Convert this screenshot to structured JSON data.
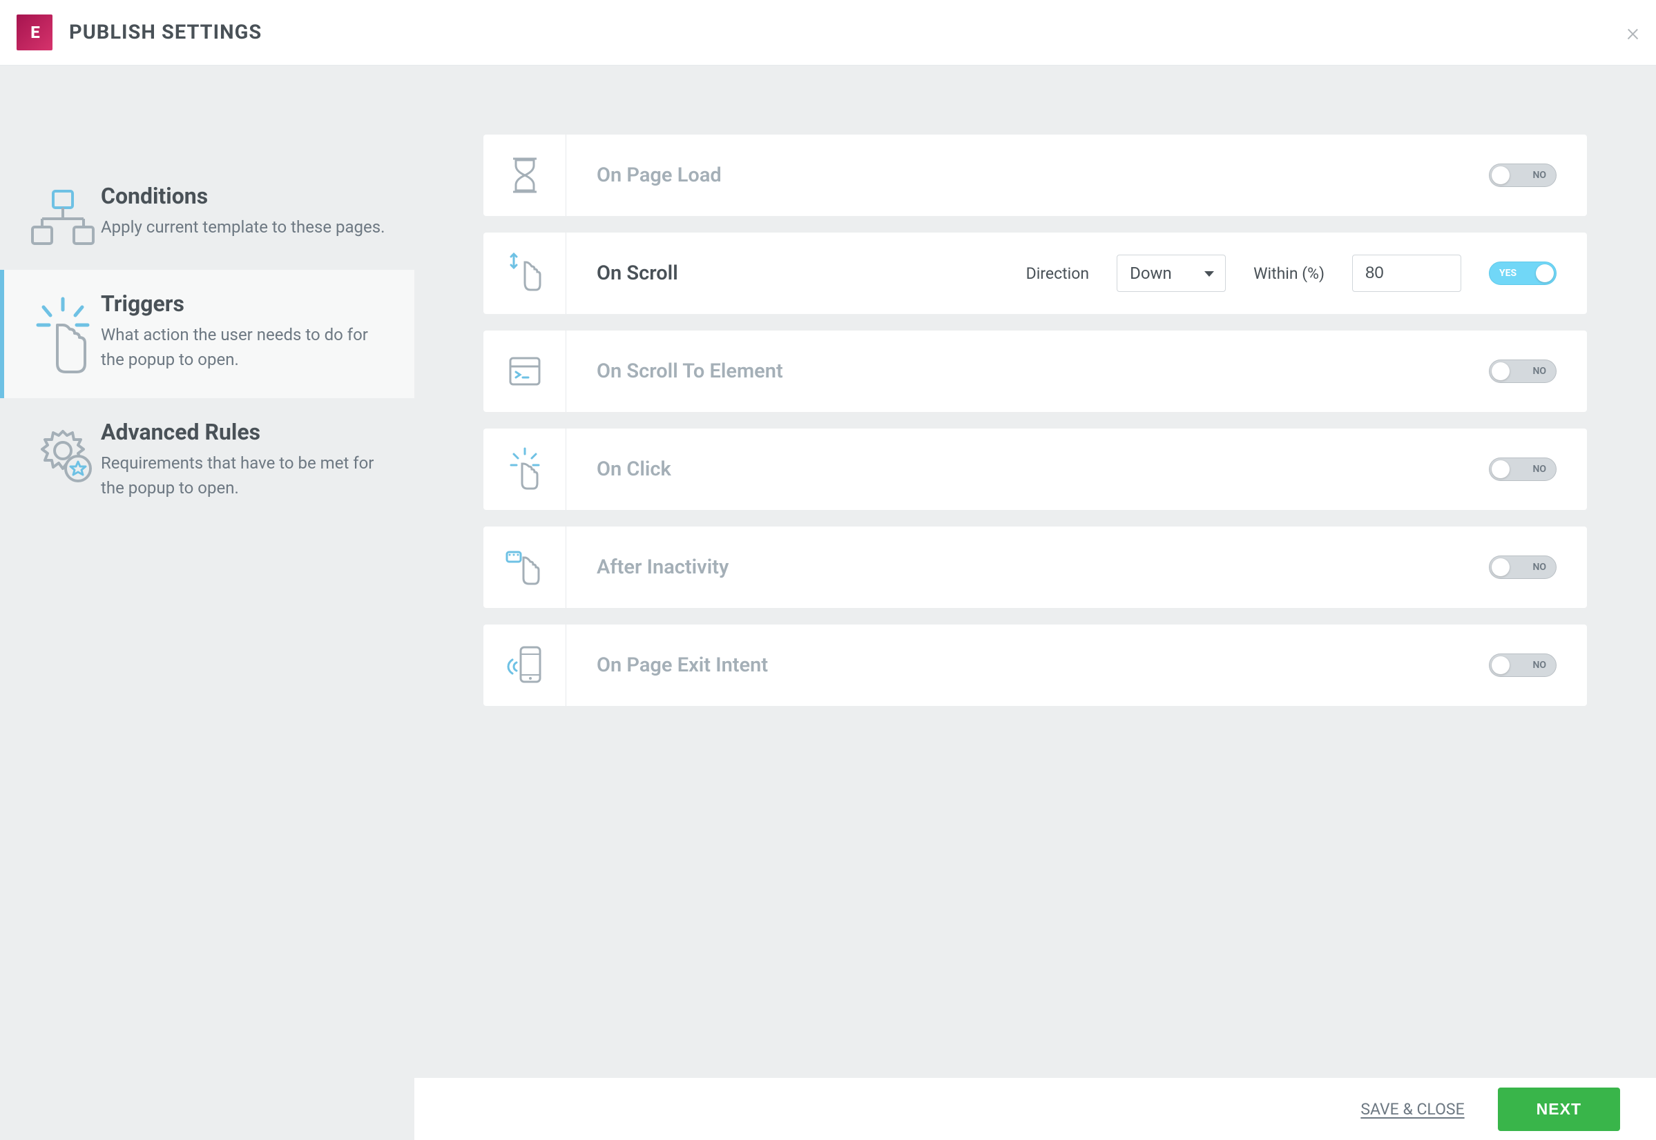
{
  "header": {
    "logo_text": "E",
    "title": "PUBLISH SETTINGS"
  },
  "sidebar": {
    "items": [
      {
        "title": "Conditions",
        "desc": "Apply current template to these pages."
      },
      {
        "title": "Triggers",
        "desc": "What action the user needs to do for the popup to open."
      },
      {
        "title": "Advanced Rules",
        "desc": "Requirements that have to be met for the popup to open."
      }
    ]
  },
  "triggers": {
    "toggle_no": "NO",
    "toggle_yes": "YES",
    "items": [
      {
        "label": "On Page Load"
      },
      {
        "label": "On Scroll"
      },
      {
        "label": "On Scroll To Element"
      },
      {
        "label": "On Click"
      },
      {
        "label": "After Inactivity"
      },
      {
        "label": "On Page Exit Intent"
      }
    ],
    "on_scroll": {
      "direction_label": "Direction",
      "direction_value": "Down",
      "within_label": "Within (%)",
      "within_value": "80"
    }
  },
  "footer": {
    "save_close": "SAVE & CLOSE",
    "next": "NEXT"
  }
}
